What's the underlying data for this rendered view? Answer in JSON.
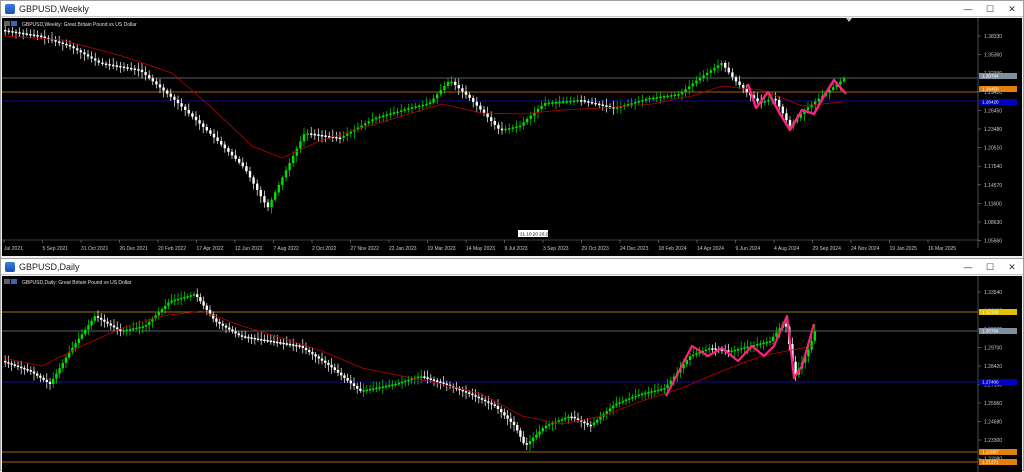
{
  "windows": [
    {
      "title": "GBPUSD,Weekly",
      "symbol_label": "GBPUSD,Weekly:  Great Britain Pound vs US Dollar",
      "price_ticks": [
        "1.38330",
        "1.35360",
        "1.32390",
        "1.29420",
        "1.26450",
        "1.23480",
        "1.20510",
        "1.17540",
        "1.14570",
        "1.11600",
        "1.08630",
        "1.05660"
      ],
      "date_ticks": [
        "Jul 2021",
        "5 Sep 2021",
        "31 Oct 2021",
        "26 Dec 2021",
        "20 Feb 2022",
        "17 Apr 2022",
        "12 Jun 2022",
        "7 Aug 2022",
        "2 Oct 2022",
        "27 Nov 2022",
        "22 Jan 2023",
        "19 Mar 2023",
        "14 May 2023",
        "9 Jul 2023",
        "3 Sep 2023",
        "29 Oct 2023",
        "24 Dec 2023",
        "18 Feb 2024",
        "14 Apr 2024",
        "9 Jun 2024",
        "4 Aug 2024",
        "29 Sep 2024",
        "24 Nov 2024",
        "19 Jan 2025",
        "16 Mar 2025"
      ],
      "price_labels": [
        {
          "text": "1.30784",
          "bg": "#8090a0"
        },
        {
          "text": "1.28450",
          "bg": "#e08010"
        },
        {
          "text": "1.26420",
          "bg": "#0000c0"
        }
      ],
      "crosshair_date": "21.10.20  20:20"
    },
    {
      "title": "GBPUSD,Daily",
      "symbol_label": "GBPUSD,Daily:  Great Britain Pound vs US Dollar",
      "price_ticks": [
        "1.33540",
        "1.32100",
        "1.30930",
        "1.29700",
        "1.28420",
        "1.27160",
        "1.25960",
        "1.24680",
        "1.23300",
        "1.22080"
      ],
      "price_labels": [
        {
          "text": "1.32100",
          "bg": "#e0c000"
        },
        {
          "text": "1.30784",
          "bg": "#8090a0"
        },
        {
          "text": "1.27400",
          "bg": "#0000c0"
        },
        {
          "text": "1.22087",
          "bg": "#e08010"
        },
        {
          "text": "1.21271",
          "bg": "#e08010"
        }
      ]
    }
  ],
  "buttons": {
    "minimize": "—",
    "maximize": "☐",
    "close": "✕"
  },
  "colors": {
    "bull": "#00e000",
    "bear": "#ffffff",
    "ma": "#c00000",
    "pattern": "#ff2080",
    "bg": "#000000"
  }
}
